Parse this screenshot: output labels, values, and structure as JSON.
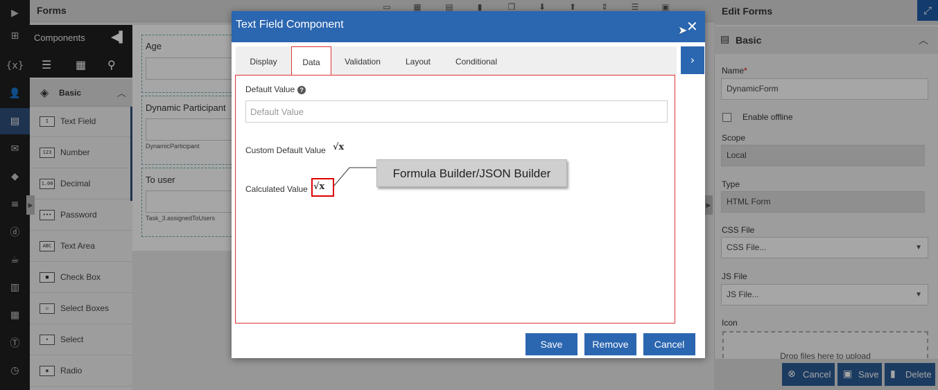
{
  "app": {
    "title": "Forms"
  },
  "components_panel": {
    "title": "Components",
    "section": "Basic",
    "items": [
      {
        "label": "Text Field",
        "icon": "I"
      },
      {
        "label": "Number",
        "icon": "123"
      },
      {
        "label": "Decimal",
        "icon": "1.00"
      },
      {
        "label": "Password",
        "icon": "•••"
      },
      {
        "label": "Text Area",
        "icon": "ABC"
      },
      {
        "label": "Check Box",
        "icon": "■"
      },
      {
        "label": "Select Boxes",
        "icon": "☑"
      },
      {
        "label": "Select",
        "icon": "▾"
      },
      {
        "label": "Radio",
        "icon": "◉"
      }
    ]
  },
  "canvas": {
    "fields": [
      {
        "label": "Age",
        "sub": ""
      },
      {
        "label": "Dynamic Participant",
        "sub": "DynamicParticipant"
      },
      {
        "label": "To user",
        "sub": "Task_3.assignedToUsers"
      }
    ]
  },
  "edit_panel": {
    "title": "Edit Forms",
    "section": "Basic",
    "name_label": "Name",
    "name_value": "DynamicForm",
    "offline_label": "Enable offline",
    "scope_label": "Scope",
    "scope_value": "Local",
    "type_label": "Type",
    "type_value": "HTML Form",
    "css_label": "CSS File",
    "css_value": "CSS File...",
    "js_label": "JS File",
    "js_value": "JS File...",
    "icon_label": "Icon",
    "dropzone_text": "Drop files here to upload",
    "cancel_label": "Cancel",
    "save_label": "Save",
    "delete_label": "Delete"
  },
  "modal": {
    "title": "Text Field Component",
    "tabs": [
      "Display",
      "Data",
      "Validation",
      "Layout",
      "Conditional"
    ],
    "active_tab": "Data",
    "default_value_label": "Default Value",
    "default_value_placeholder": "Default Value",
    "custom_default_label": "Custom Default Value",
    "calculated_label": "Calculated Value",
    "sqrt_glyph": "√x",
    "callout": "Formula Builder/JSON Builder",
    "save_label": "Save",
    "remove_label": "Remove",
    "cancel_label": "Cancel"
  },
  "colors": {
    "primary": "#2b66b0",
    "highlight": "#dd0000",
    "rail": "#1f1f1f"
  }
}
